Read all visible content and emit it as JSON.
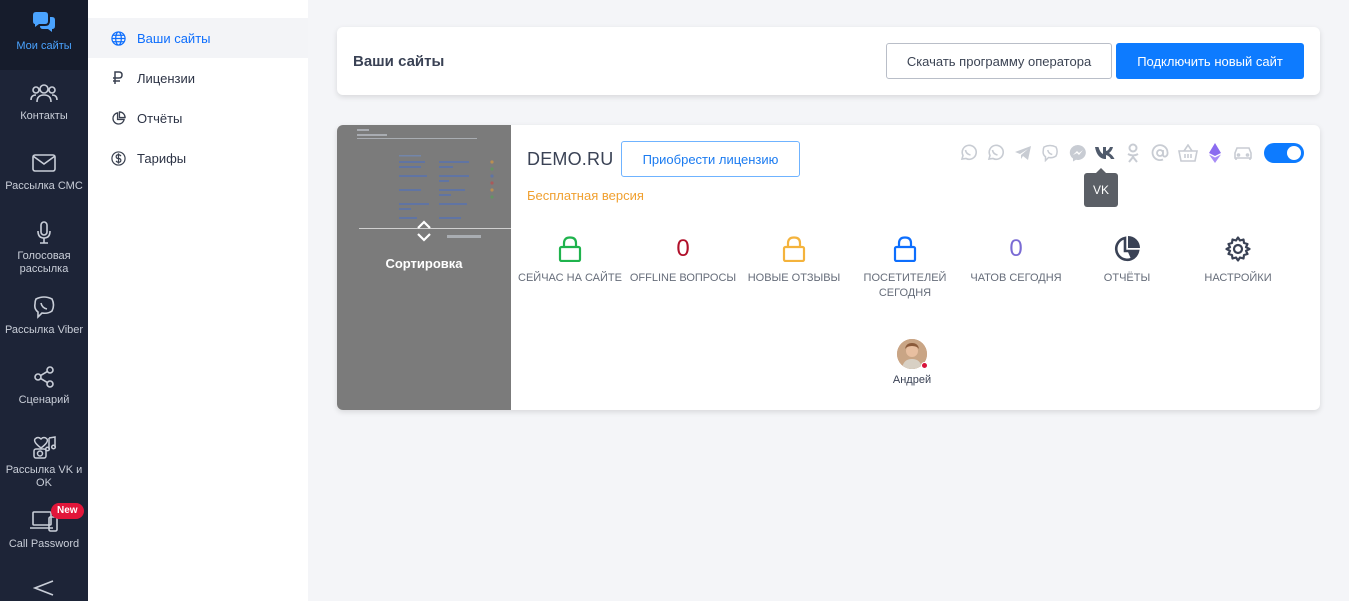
{
  "rail": {
    "items": [
      {
        "label": "Мои сайты",
        "icon": "chat-bubbles-icon",
        "active": true
      },
      {
        "label": "Контакты",
        "icon": "users-icon"
      },
      {
        "label": "Рассылка СМС",
        "icon": "envelope-icon"
      },
      {
        "label": "Голосовая рассылка",
        "icon": "microphone-icon"
      },
      {
        "label": "Рассылка Viber",
        "icon": "viber-icon"
      },
      {
        "label": "Сценарий",
        "icon": "share-nodes-icon"
      },
      {
        "label": "Рассылка VK и OK",
        "icon": "social-broadcast-icon"
      },
      {
        "label": "Call Password",
        "icon": "devices-icon",
        "badge": "New"
      }
    ]
  },
  "submenu": {
    "items": [
      {
        "label": "Ваши сайты",
        "icon": "globe-icon",
        "active": true
      },
      {
        "label": "Лицензии",
        "icon": "ruble-icon"
      },
      {
        "label": "Отчёты",
        "icon": "pie-chart-icon"
      },
      {
        "label": "Тарифы",
        "icon": "dollar-circle-icon"
      }
    ]
  },
  "header": {
    "title": "Ваши сайты",
    "download_label": "Скачать программу оператора",
    "connect_label": "Подключить новый сайт"
  },
  "site": {
    "thumbnail_label": "Сортировка",
    "name": "DEMO.RU",
    "license_button": "Приобрести лицензию",
    "plan": "Бесплатная версия",
    "channels": [
      "whatsapp-icon",
      "whatsapp-icon",
      "telegram-icon",
      "viber-icon",
      "messenger-icon",
      "vk-icon",
      "odnoklassniki-icon",
      "email-icon",
      "basket-icon",
      "ethereum-icon",
      "car-icon"
    ],
    "tooltip": "VK",
    "enabled": true,
    "stats": [
      {
        "value": "",
        "icon": "lock-icon",
        "color": "#1fb34d",
        "label": "СЕЙЧАС НА САЙТЕ"
      },
      {
        "value": "0",
        "color": "#b0102a",
        "label": "OFFLINE ВОПРОСЫ"
      },
      {
        "value": "",
        "icon": "lock-icon",
        "color": "#f4b33c",
        "label": "НОВЫЕ ОТЗЫВЫ"
      },
      {
        "value": "",
        "icon": "lock-icon",
        "color": "#0d6efd",
        "label": "ПОСЕТИТЕЛЕЙ СЕГОДНЯ"
      },
      {
        "value": "0",
        "color": "#7a6bd4",
        "label": "ЧАТОВ СЕГОДНЯ"
      },
      {
        "value": "",
        "icon": "pie-chart-icon",
        "color": "#3a4255",
        "label": "ОТЧЁТЫ"
      },
      {
        "value": "",
        "icon": "gear-icon",
        "color": "#3a4255",
        "label": "НАСТРОЙКИ"
      }
    ],
    "operator": {
      "name": "Андрей",
      "status_color": "#d8123a"
    }
  },
  "colors": {
    "accent": "#0d7bff",
    "rail_bg": "#1d2437",
    "free_version": "#f0a030"
  }
}
